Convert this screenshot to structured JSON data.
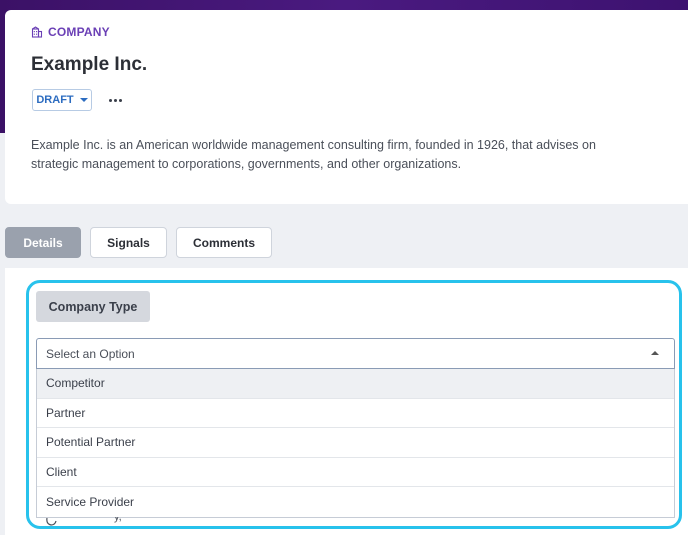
{
  "header": {
    "entity_type": "COMPANY",
    "entity_icon": "building-icon",
    "title": "Example Inc.",
    "status_label": "DRAFT",
    "description": "Example Inc. is an American worldwide management consulting firm, founded in 1926, that advises on strategic management to corporations, governments, and other organizations."
  },
  "tabs": [
    {
      "label": "Details",
      "active": true
    },
    {
      "label": "Signals",
      "active": false
    },
    {
      "label": "Comments",
      "active": false
    }
  ],
  "field": {
    "label": "Company Type",
    "placeholder": "Select an Option",
    "options": [
      "Competitor",
      "Partner",
      "Potential Partner",
      "Client",
      "Service Provider"
    ],
    "hovered_option": "Competitor"
  },
  "colors": {
    "brand_band": "#3b1166",
    "accent_purple": "#6a3fb5",
    "status_blue": "#2c6cc0",
    "highlight_cyan": "#28c2ec",
    "active_tab": "#9aa1ad"
  }
}
